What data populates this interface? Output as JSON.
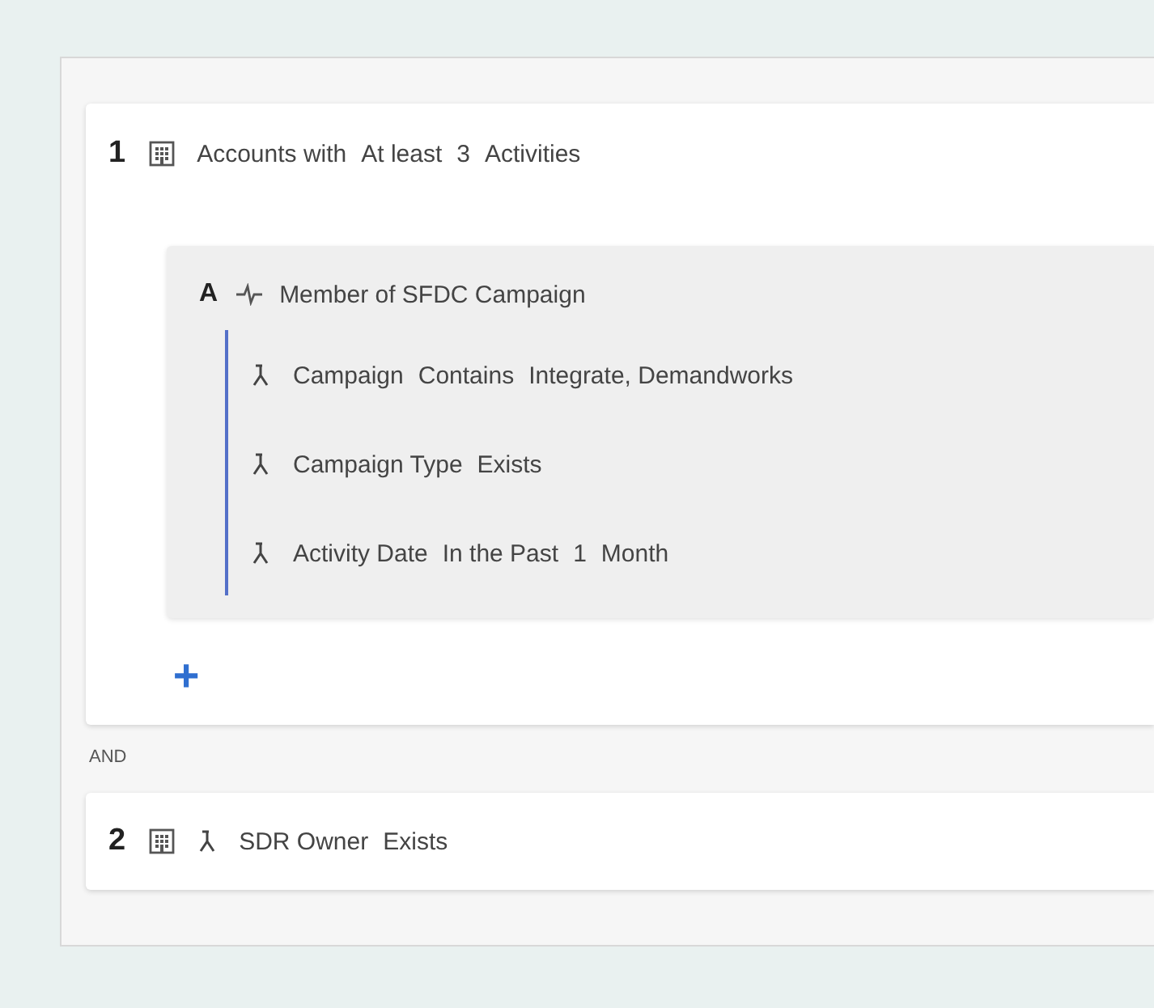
{
  "groups": [
    {
      "number": "1",
      "parts": [
        "Accounts with",
        "At least",
        "3",
        "Activities"
      ],
      "subgroup": {
        "letter": "A",
        "title": "Member of SFDC Campaign",
        "filters": [
          {
            "parts": [
              "Campaign",
              "Contains",
              "Integrate, Demandworks"
            ]
          },
          {
            "parts": [
              "Campaign Type",
              "Exists"
            ]
          },
          {
            "parts": [
              "Activity Date",
              "In the Past",
              "1",
              "Month"
            ]
          }
        ]
      },
      "add_label": "+"
    },
    {
      "number": "2",
      "person_icon": true,
      "parts": [
        "SDR Owner",
        "Exists"
      ]
    }
  ],
  "connector": "AND"
}
